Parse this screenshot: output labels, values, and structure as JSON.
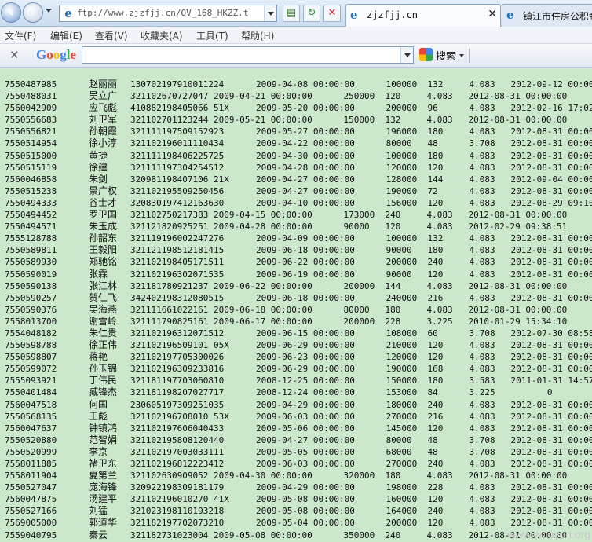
{
  "browser": {
    "address_url": "ftp://www.zjzfjj.cn/OV_168_HKZZ.t",
    "tabs": [
      {
        "title": "zjzfjj.cn",
        "close": "✕"
      },
      {
        "title": "镇江市住房公积金"
      }
    ]
  },
  "menu": {
    "items": [
      "文件(F)",
      "编辑(E)",
      "查看(V)",
      "收藏夹(A)",
      "工具(T)",
      "帮助(H)"
    ]
  },
  "google_toolbar": {
    "logo": "Google",
    "search_button": "搜索",
    "close": "✕"
  },
  "records": [
    [
      "7550487985",
      "赵丽丽",
      "130702197910011224",
      "2009-04-08 00:00:00      100000  132     4.083   2012-09-12 00:00"
    ],
    [
      "7550488031",
      "吴立广",
      "321102670727047 2009-04-21 00:00:00      250000  120     4.083   2012-08-31 00:00:00"
    ],
    [
      "7560042909",
      "应飞彪",
      "410882198405066 51X",
      "2009-05-20 00:00:00      200000  96      4.083   2012-02-16 17:02"
    ],
    [
      "7550556683",
      "刘卫军",
      "321102701123244 2009-05-21 00:00:00      150000  132     4.083   2012-08-31 00:00:00"
    ],
    [
      "7550556821",
      "孙朝霞",
      "321111197509152923",
      "2009-05-27 00:00:00      196000  180     4.083   2012-08-31 00:00"
    ],
    [
      "7550514954",
      "徐小淳",
      "321102196011110434",
      "2009-04-22 00:00:00      80000   48      3.708   2012-08-31 00:00"
    ],
    [
      "7550515000",
      "黄捷",
      "321111198406225725",
      "2009-04-30 00:00:00      100000  180     4.083   2012-08-31 00:00"
    ],
    [
      "7550515119",
      "徐建",
      "321111197304254512",
      "2009-04-28 00:00:00      120000  120     4.083   2012-08-31 00:00"
    ],
    [
      "7560046858",
      "朱剑",
      "320981198407106 21X",
      "2009-04-27 00:00:00      128000  144     4.083   2012-09-04 00:00"
    ],
    [
      "7550515238",
      "景广权",
      "321102195509250456",
      "2009-04-27 00:00:00      190000  72      4.083   2012-08-31 00:00"
    ],
    [
      "7550494333",
      "谷士才",
      "320830197412163630",
      "2009-04-10 00:00:00      156000  120     4.083   2012-08-29 09:10"
    ],
    [
      "7550494452",
      "罗卫国",
      "321102750217383 2009-04-15 00:00:00      173000  240     4.083   2012-08-31 00:00:00"
    ],
    [
      "7550494571",
      "朱玉成",
      "321121820925251 2009-04-28 00:00:00      90000   120     4.083   2012-02-29 09:38:51"
    ],
    [
      "7555128788",
      "孙韶东",
      "321119196002247276",
      "2009-04-09 00:00:00      100000  132     4.083   2012-08-31 00:00"
    ],
    [
      "7550589811",
      "王毅阳",
      "321121198512181415",
      "2009-06-18 00:00:00      90000   180     4.083   2012-08-31 00:00"
    ],
    [
      "7550589930",
      "郑驰铭",
      "321102198405171511",
      "2009-06-22 00:00:00      200000  240     4.083   2012-08-31 00:00"
    ],
    [
      "7550590019",
      "张霖",
      "321102196302071535",
      "2009-06-19 00:00:00      90000   120     4.083   2012-08-31 00:00"
    ],
    [
      "7550590138",
      "张江林",
      "321181780921237 2009-06-22 00:00:00      200000  144     4.083   2012-08-31 00:00:00"
    ],
    [
      "7550590257",
      "贺仁飞",
      "342402198312080515",
      "2009-06-18 00:00:00      240000  216     4.083   2012-08-31 00:00"
    ],
    [
      "7550590376",
      "吴海燕",
      "321111661022161 2009-06-18 00:00:00      80000   180     4.083   2012-08-31 00:00:00"
    ],
    [
      "7558013700",
      "谢雪岭",
      "321111790825161 2009-06-17 00:00:00      200000  228     3.225   2010-01-29 15:34:10"
    ],
    [
      "7554048182",
      "朱仁贵",
      "321102196312071512",
      "2009-06-15 00:00:00      108000  60      3.708   2012-07-30 08:58"
    ],
    [
      "7550598788",
      "徐正伟",
      "321102196509101 05X",
      "2009-06-29 00:00:00      210000  120     4.083   2012-08-31 00:00"
    ],
    [
      "7550598807",
      "蒋艳",
      "321102197705300026",
      "2009-06-23 00:00:00      120000  120     4.083   2012-08-31 00:00"
    ],
    [
      "7550599072",
      "孙玉锦",
      "321102196309233816",
      "2009-06-29 00:00:00      190000  168     4.083   2012-08-31 00:00"
    ],
    [
      "7555093921",
      "丁伟民",
      "321181197703060810",
      "2008-12-25 00:00:00      150000  180     3.583   2011-01-31 14:57"
    ],
    [
      "7550401484",
      "臧锋杰",
      "321181198207027717",
      "2008-12-24 00:00:00      153000  84      3.225          0"
    ],
    [
      "7560047518",
      "何国",
      "230605197309251035",
      "2009-04-29 00:00:00      180000  240     4.083   2012-08-31 00:00"
    ],
    [
      "7550568135",
      "王彪",
      "321102196708010 53X",
      "2009-06-03 00:00:00      270000  216     4.083   2012-08-31 00:00"
    ],
    [
      "7560047637",
      "钟镇鸿",
      "321102197606040433",
      "2009-05-06 00:00:00      145000  120     4.083   2012-08-31 00:00"
    ],
    [
      "7550520880",
      "范智娟",
      "321102195808120440",
      "2009-04-27 00:00:00      80000   48      3.708   2012-08-31 00:00"
    ],
    [
      "7550520999",
      "李京",
      "321102197003033111",
      "2009-05-05 00:00:00      68000   48      3.708   2012-08-31 00:00"
    ],
    [
      "7558011885",
      "褚卫东",
      "321102196812223412",
      "2009-06-03 00:00:00      270000  240     4.083   2012-08-31 00:00"
    ],
    [
      "7558011904",
      "夏第兰",
      "321102630909052 2009-04-30 00:00:00      320000  180     4.083   2012-08-31 00:00:00"
    ],
    [
      "7550527047",
      "庞海锋",
      "320922198309181179",
      "2009-04-29 00:00:00      198000  228     4.083   2012-08-31 00:00"
    ],
    [
      "7560047875",
      "汤建平",
      "321102196010270 41X",
      "2009-05-08 00:00:00      160000  120     4.083   2012-08-31 00:00"
    ],
    [
      "7550527166",
      "刘猛",
      "321023198110193218",
      "2009-05-08 00:00:00      164000  240     4.083   2012-08-31 00:00"
    ],
    [
      "7569005000",
      "郭道华",
      "321182197702073210",
      "2009-05-04 00:00:00      200000  120     4.083   2012-08-31 00:00"
    ],
    [
      "7559040795",
      "秦云",
      "321182731023004 2009-05-08 00:00:00      350000  240     4.083   2012-08-31 00:00:00"
    ]
  ],
  "watermark": "www.wooyun.org"
}
